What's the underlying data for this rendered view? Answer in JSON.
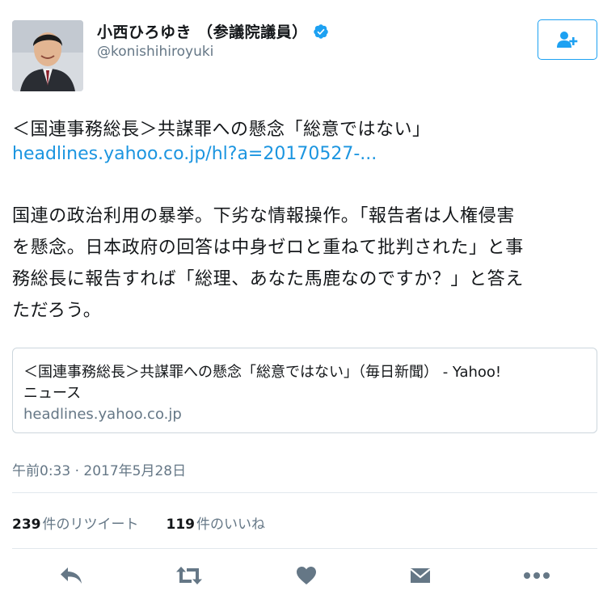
{
  "author": {
    "display_name": "小西ひろゆき （参議院議員）",
    "handle": "@konishihiroyuki",
    "verified": true,
    "avatar_alt": "profile photo"
  },
  "follow_button": {
    "icon": "follow-user-icon"
  },
  "tweet": {
    "line1": "＜国連事務総長＞共謀罪への懸念「総意ではない」",
    "link_text": "headlines.yahoo.co.jp/hl?a=20170527-...",
    "body_lines": [
      "国連の政治利用の暴挙。下劣な情報操作。「報告者は人権侵害",
      "を懸念。日本政府の回答は中身ゼロと重ねて批判された」と事",
      "務総長に報告すれば「総理、あなた馬鹿なのですか？」と答え",
      "ただろう。"
    ]
  },
  "card": {
    "title_lines": [
      "＜国連事務総長＞共謀罪への懸念「総意ではない」（毎日新聞） - Yahoo!",
      "ニュース"
    ],
    "domain": "headlines.yahoo.co.jp"
  },
  "timestamp": "午前0:33 · 2017年5月28日",
  "stats": {
    "retweets_count": "239",
    "retweets_label": "件のリツイート",
    "likes_count": "119",
    "likes_label": "件のいいね"
  },
  "actions": [
    "reply-icon",
    "retweet-icon",
    "like-icon",
    "direct-message-icon",
    "more-icon"
  ],
  "colors": {
    "link": "#1b95e0",
    "verified": "#1da1f2",
    "secondary_text": "#657786",
    "action_icon": "#657786",
    "border": "#e1e8ed"
  }
}
